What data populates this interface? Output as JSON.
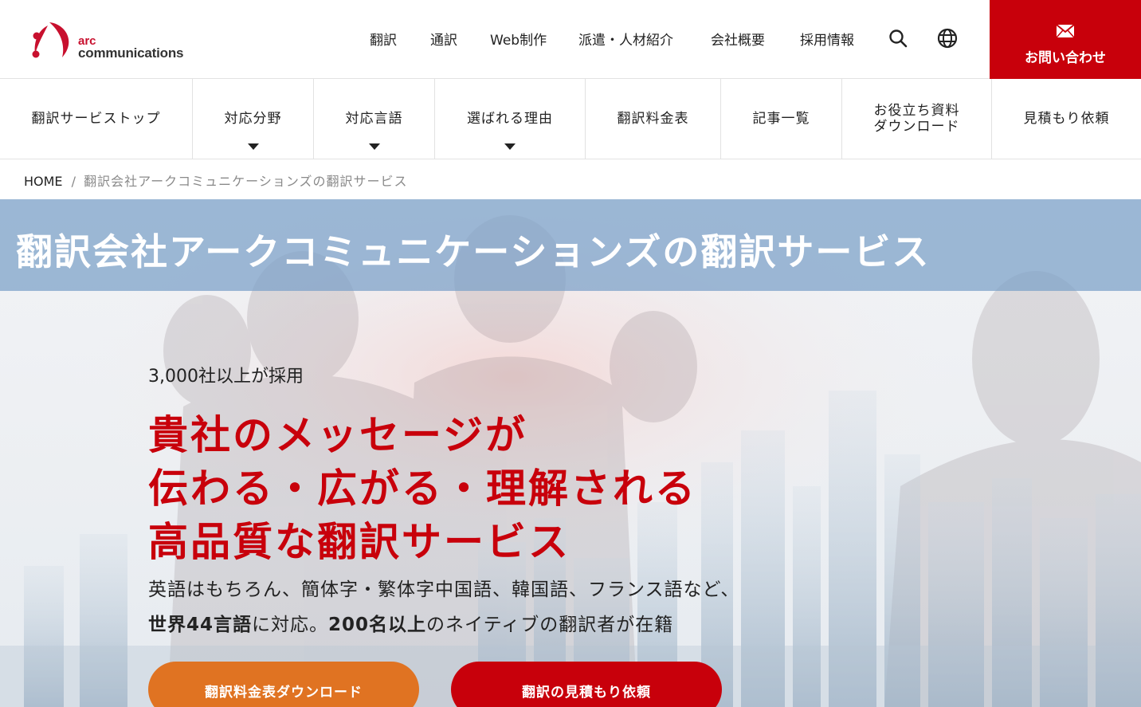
{
  "brand": {
    "line1": "arc",
    "line2": "communications",
    "accent": "#c8102e"
  },
  "top_nav": [
    {
      "label": "翻訳"
    },
    {
      "label": "通訳"
    },
    {
      "label": "Web制作"
    },
    {
      "label": "派遣・人材紹介"
    },
    {
      "label": "会社概要"
    },
    {
      "label": "採用情報"
    }
  ],
  "icons": {
    "search": "search-icon",
    "language": "globe-icon",
    "mail": "mail-icon"
  },
  "contact": {
    "label": "お問い合わせ",
    "color": "#c8000b"
  },
  "sub_nav": [
    {
      "label": "翻訳サービストップ",
      "dropdown": false
    },
    {
      "label": "対応分野",
      "dropdown": true
    },
    {
      "label": "対応言語",
      "dropdown": true
    },
    {
      "label": "選ばれる理由",
      "dropdown": true
    },
    {
      "label": "翻訳料金表",
      "dropdown": false
    },
    {
      "label": "記事一覧",
      "dropdown": false
    },
    {
      "label_line1": "お役立ち資料",
      "label_line2": "ダウンロード",
      "dropdown": false
    },
    {
      "label": "見積もり依頼",
      "dropdown": false
    }
  ],
  "breadcrumb": {
    "home": "HOME",
    "separator": "/",
    "current": "翻訳会社アークコミュニケーションズの翻訳サービス"
  },
  "hero": {
    "title": "翻訳会社アークコミュニケーションズの翻訳サービス",
    "tagline": "3,000社以上が採用",
    "headline": [
      "貴社のメッセージが",
      "伝わる・広がる・理解される",
      "高品質な翻訳サービス"
    ],
    "desc_line1": "英語はもちろん、簡体字・繁体字中国語、韓国語、フランス語など、",
    "desc_line2_bold1": "世界44言語",
    "desc_line2_mid": "に対応。",
    "desc_line2_bold2": "200名以上",
    "desc_line2_end": "のネイティブの翻訳者が在籍",
    "headline_color": "#c8000b"
  },
  "cta": {
    "download": "翻訳料金表ダウンロード",
    "estimate": "翻訳の見積もり依頼",
    "download_color": "#e07322",
    "estimate_color": "#c8000b"
  }
}
